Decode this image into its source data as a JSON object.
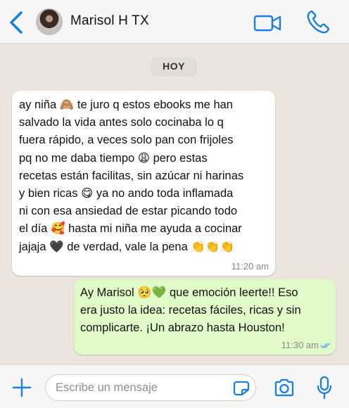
{
  "header": {
    "contact_name": "Marisol H TX",
    "back_icon": "chevron-left-icon",
    "video_icon": "video-camera-icon",
    "call_icon": "phone-icon",
    "accent_color": "#1a7fe0"
  },
  "chat": {
    "day_label": "HOY",
    "messages": [
      {
        "direction": "incoming",
        "text": "ay niña 🙈 te juro q estos ebooks me han\nsalvado la vida antes solo cocinaba lo q\nfuera rápido, a veces solo pan con frijoles\npq no me daba tiempo 😩 pero estas\nrecetas están facilitas, sin azúcar ni harinas\ny bien ricas 😋 ya no ando toda inflamada\nni con esa ansiedad de estar picando todo\nel día 🥰 hasta mi niña me ayuda a cocinar\njajaja 🖤 de verdad, vale la pena 👏👏👏",
        "time": "11:20 am",
        "bubble_color": "#ffffff"
      },
      {
        "direction": "outgoing",
        "text": "Ay Marisol 🥺💚 que emoción leerte!! Eso\nera justo la idea: recetas fáciles, ricas y sin\ncomplicarte. ¡Un abrazo hasta Houston!",
        "time": "11:30 am",
        "status_icon": "double-check-read-icon",
        "bubble_color": "#e0fbc8"
      }
    ]
  },
  "composer": {
    "placeholder": "Escribe un mensaje",
    "value": "",
    "plus_icon": "plus-icon",
    "sticker_icon": "sticker-icon",
    "camera_icon": "camera-icon",
    "mic_icon": "microphone-icon"
  }
}
